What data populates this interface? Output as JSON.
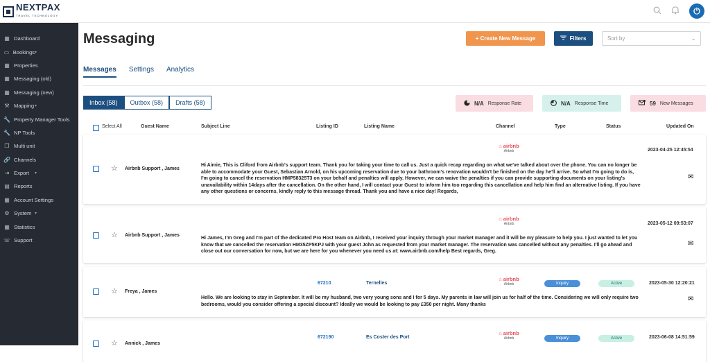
{
  "brand": {
    "name": "NEXTPAX",
    "sub": "TRAVEL TECHNOLOGY"
  },
  "icons": {
    "search": "search-icon",
    "bell": "bell-icon",
    "power": "power-icon"
  },
  "sidebar": {
    "items": [
      {
        "label": "Dashboard",
        "icon": "grid-icon",
        "chevron": false
      },
      {
        "label": "Bookings",
        "icon": "card-icon",
        "chevron": true
      },
      {
        "label": "Properties",
        "icon": "grid-icon",
        "chevron": false
      },
      {
        "label": "Messaging (old)",
        "icon": "grid-icon",
        "chevron": false
      },
      {
        "label": "Messaging (new)",
        "icon": "grid-icon",
        "chevron": false
      },
      {
        "label": "Mapping",
        "icon": "mapping-icon",
        "chevron": true
      },
      {
        "label": "Property Manager Tools",
        "icon": "wrench-icon",
        "chevron": false
      },
      {
        "label": "NP Tools",
        "icon": "wrench-icon",
        "chevron": false
      },
      {
        "label": "Multi unit",
        "icon": "copy-icon",
        "chevron": false
      },
      {
        "label": "Channels",
        "icon": "link-icon",
        "chevron": false
      },
      {
        "label": "Export",
        "icon": "export-icon",
        "chevron": true
      },
      {
        "label": "Reports",
        "icon": "report-icon",
        "chevron": false
      },
      {
        "label": "Account Settings",
        "icon": "grid-icon",
        "chevron": false
      },
      {
        "label": "System",
        "icon": "gear-icon",
        "chevron": true
      },
      {
        "label": "Statistics",
        "icon": "grid-icon",
        "chevron": false
      },
      {
        "label": "Support",
        "icon": "phone-icon",
        "chevron": false
      }
    ]
  },
  "header": {
    "title": "Messaging",
    "create_label": "+ Create New Message",
    "filters_label": "Filters",
    "sort_placeholder": "Sort by"
  },
  "tabs": [
    {
      "label": "Messages",
      "active": true
    },
    {
      "label": "Settings",
      "active": false
    },
    {
      "label": "Analytics",
      "active": false
    }
  ],
  "boxtabs": [
    {
      "label": "Inbox (58)",
      "active": true
    },
    {
      "label": "Outbox (58)",
      "active": false
    },
    {
      "label": "Drafts (58)",
      "active": false
    }
  ],
  "stats": [
    {
      "value": "N/A",
      "label": "Response Rate",
      "icon": "pie-icon",
      "color": "#f9dde2"
    },
    {
      "value": "N/A",
      "label": "Response Time",
      "icon": "clock-icon",
      "color": "#d6f1ec"
    },
    {
      "value": "59",
      "label": "New Messages",
      "icon": "message-icon",
      "color": "#f9dde2"
    }
  ],
  "columns": {
    "select_all": "Select All",
    "guest": "Guest Name",
    "subject": "Subject Line",
    "listing_id": "Listing ID",
    "listing_name": "Listing Name",
    "channel": "Channel",
    "type": "Type",
    "status": "Status",
    "updated": "Updated On"
  },
  "rows": [
    {
      "guest": "Airbnb Support , James",
      "listing_id": "",
      "listing_name": "",
      "channel": "airbnb",
      "channel_sub": "Airbnb",
      "type": "",
      "status": "",
      "updated": "2023-04-25 12:45:54",
      "message": "Hi Aimie, This is Cliford from Airbnb's support team. Thank you for taking your time to call us. Just a quick recap regarding on what we've talked about over the phone. You can no longer be able to accommodate your Guest, Sebastian Arnold, on his upcoming reservation due to your bathroom's renovation wouldn't be finished on the day he'll arrive. So what I'm going to do is, I'm going to cancel the reservation HMP58325T3 on your behalf and penalties will apply. However, we can waive the penalties if you can provide supporting documents on your listing's unavailability within 14days after the cancellation. On the other hand, I will contact your Guest to inform him too regarding this cancellation and help him find an alternative listing. If you have any other questions or concerns, kindly reply to this message thread. Thank you and have a nice day! Regards,"
    },
    {
      "guest": "Airbnb Support , James",
      "listing_id": "",
      "listing_name": "",
      "channel": "airbnb",
      "channel_sub": "Airbnb",
      "type": "",
      "status": "",
      "updated": "2023-05-12 09:53:07",
      "message": "Hi James, I'm Greg and I'm part of the dedicated Pro Host team on Airbnb, I received your inquiry through your market manager and it will be my pleasure to help you. I just wanted to let you know that we cancelled the reservation HM35ZP5KPJ with your guest John as requested from your market manager. The reservation was cancelled without any penalties. I'll go ahead and close out our conversation for now, but we are here for you whenever you need us at: www.airbnb.com/help Best regards, Greg."
    },
    {
      "guest": "Freya , James",
      "listing_id": "67210",
      "listing_name": "Ternelles",
      "channel": "airbnb",
      "channel_sub": "Airbnb",
      "type": "Inquiry",
      "status": "Active",
      "updated": "2023-05-30 12:20:21",
      "message": "Hello. We are looking to stay in September. It will be my husband, two very young sons and I for 5 days. My parents in law will join us for half of the time. Considering we will only require two bedrooms, would you consider offering a special discount? Ideally we would be looking to pay £350 per night. Many thanks"
    },
    {
      "guest": "Annick , James",
      "listing_id": "672190",
      "listing_name": "Es Coster des Port",
      "channel": "airbnb",
      "channel_sub": "Airbnb",
      "type": "Inquiry",
      "status": "Active",
      "updated": "2023-06-08 14:51:59",
      "message": ""
    }
  ]
}
